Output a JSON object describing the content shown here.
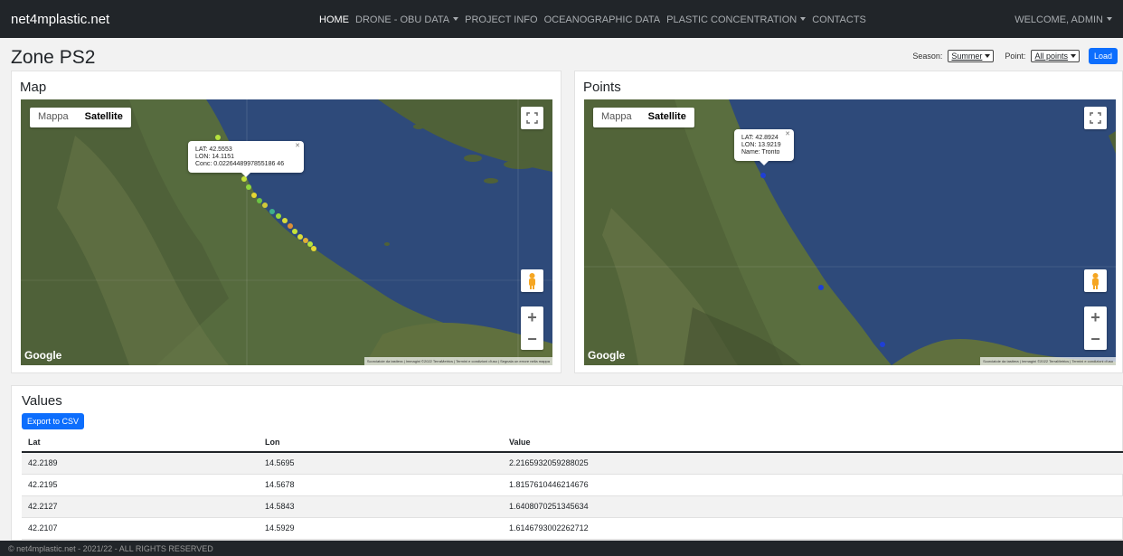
{
  "navbar": {
    "brand": "net4mplastic.net",
    "items": [
      {
        "label": "HOME",
        "dropdown": false,
        "active": true
      },
      {
        "label": "DRONE - OBU DATA",
        "dropdown": true,
        "active": false
      },
      {
        "label": "PROJECT INFO",
        "dropdown": false,
        "active": false
      },
      {
        "label": "OCEANOGRAPHIC DATA",
        "dropdown": false,
        "active": false
      },
      {
        "label": "PLASTIC CONCENTRATION",
        "dropdown": true,
        "active": false
      },
      {
        "label": "CONTACTS",
        "dropdown": false,
        "active": false
      }
    ],
    "user": "WELCOME, ADMIN"
  },
  "page": {
    "title": "Zone PS2",
    "season_label": "Season:",
    "season_value": "Summer",
    "point_label": "Point:",
    "point_value": "All points",
    "load_button": "Load"
  },
  "map_panel": {
    "title": "Map",
    "maptype_road": "Mappa",
    "maptype_sat": "Satellite",
    "infowindow": {
      "lat": "LAT: 42.5553",
      "lon": "LON: 14.1151",
      "conc": "Conc: 0.0226448997855186 46"
    },
    "google": "Google",
    "attribution": "Scorciatoie da tastiera | Immagini ©2022 TerraMetrics | Termini e condizioni d'uso | Segnala un errore nella mappa"
  },
  "points_panel": {
    "title": "Points",
    "maptype_road": "Mappa",
    "maptype_sat": "Satellite",
    "infowindow": {
      "lat": "LAT: 42.8924",
      "lon": "LON: 13.9219",
      "name": "Name: Tronto"
    },
    "google": "Google",
    "attribution": "Scorciatoie da tastiera | Immagini ©2022 TerraMetrics | Termini e condizioni d'uso"
  },
  "values": {
    "title": "Values",
    "export_button": "Export to CSV",
    "columns": [
      "Lat",
      "Lon",
      "Value"
    ],
    "rows": [
      [
        "42.2189",
        "14.5695",
        "2.2165932059288025"
      ],
      [
        "42.2195",
        "14.5678",
        "1.8157610446214676"
      ],
      [
        "42.2127",
        "14.5843",
        "1.6408070251345634"
      ],
      [
        "42.2107",
        "14.5929",
        "1.6146793002262712"
      ]
    ]
  },
  "footer": {
    "text": "© net4mplastic.net - 2021/22 - ALL RIGHTS RESERVED"
  },
  "colors": {
    "navbar": "#212529",
    "primary": "#0d6efd",
    "sea": "#2e4a7a",
    "land": "#566b3e"
  }
}
